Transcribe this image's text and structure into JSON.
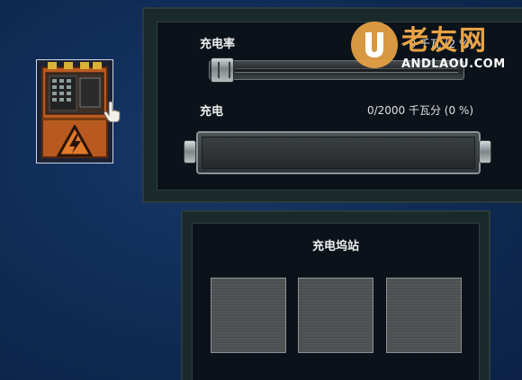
{
  "charge_rate": {
    "label": "充电率",
    "value_text": "0 千瓦 (2 %)",
    "level_percent": 2
  },
  "charge": {
    "label": "充电",
    "value_text": "0/2000 千瓦分 (0 %)",
    "current": 0,
    "capacity": 2000,
    "fill_fraction": 0
  },
  "dock": {
    "title": "充电坞站",
    "slots": [
      {
        "state": "empty"
      },
      {
        "state": "empty"
      },
      {
        "state": "empty"
      }
    ]
  },
  "machine": {
    "icon": "electric-charger-cabinet-icon",
    "warning_icon": "high-voltage-warning-icon"
  },
  "watermark": {
    "brand_text": "老友网",
    "domain_text": "ANDLAOU.COM"
  },
  "colors": {
    "background": "#0f2a52",
    "panel": "#0c121a",
    "charge_fill": "#4fae3a",
    "watermark_orange": "#e9a444"
  }
}
